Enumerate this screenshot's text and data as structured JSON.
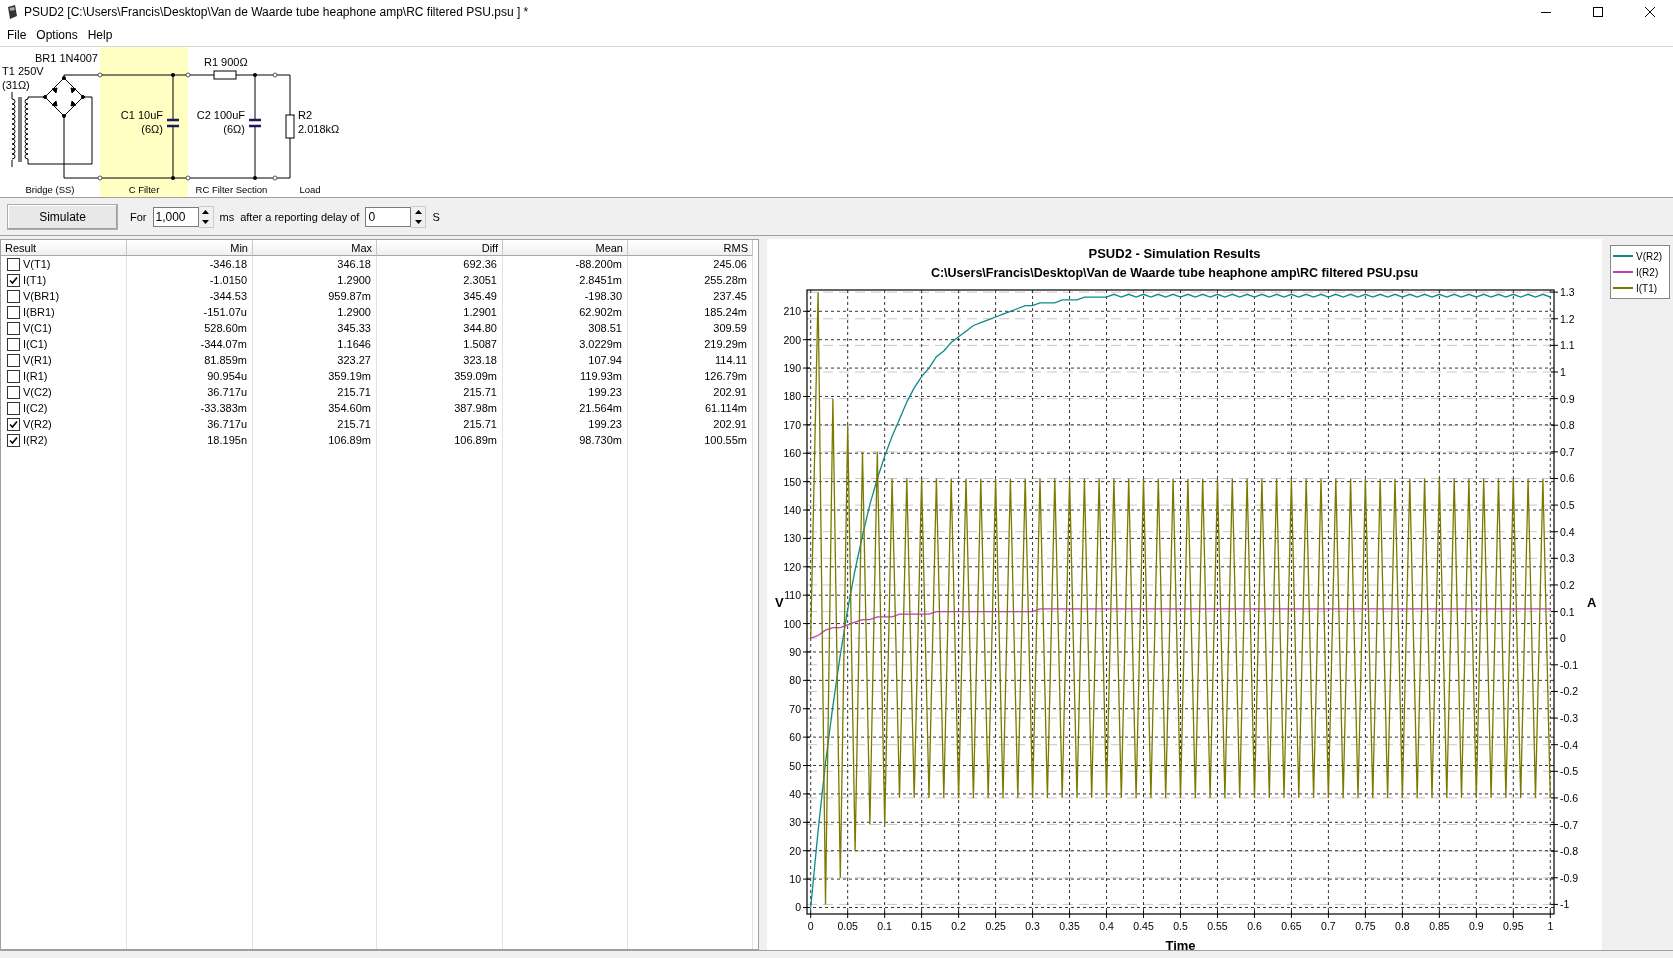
{
  "window": {
    "title": "PSUD2  [C:\\Users\\Francis\\Desktop\\Van de Waarde tube heaphone amp\\RC filtered PSU.psu ] *"
  },
  "menu": [
    "File",
    "Options",
    "Help"
  ],
  "schematic": {
    "components": [
      {
        "kind": "transformer",
        "label": "T1 250V",
        "detail": "(31Ω)"
      },
      {
        "kind": "bridge",
        "label": "BR1 1N4007"
      },
      {
        "kind": "capacitor",
        "label": "C1 10uF",
        "detail": "(6Ω)"
      },
      {
        "kind": "resistor",
        "label": "R1 900Ω"
      },
      {
        "kind": "capacitor",
        "label": "C2 100uF",
        "detail": "(6Ω)"
      },
      {
        "kind": "load",
        "label": "R2",
        "detail": "2.018kΩ"
      }
    ],
    "sections": [
      {
        "label": "Bridge (SS)",
        "selected": false
      },
      {
        "label": "C Filter",
        "selected": true
      },
      {
        "label": "RC Filter Section",
        "selected": false
      },
      {
        "label": "Load",
        "selected": false
      }
    ]
  },
  "controls": {
    "simulate": "Simulate",
    "for_label": "For",
    "duration": "1,000",
    "duration_unit": "ms",
    "delay_label": "after a reporting delay of",
    "delay": "0",
    "delay_unit": "S"
  },
  "results": {
    "columns": [
      "Result",
      "Min",
      "Max",
      "Diff",
      "Mean",
      "RMS"
    ],
    "rows": [
      {
        "result": "V(T1)",
        "checked": false,
        "min": "-346.18",
        "max": "346.18",
        "diff": "692.36",
        "mean": "-88.200m",
        "rms": "245.06"
      },
      {
        "result": "I(T1)",
        "checked": true,
        "min": "-1.0150",
        "max": "1.2900",
        "diff": "2.3051",
        "mean": "2.8451m",
        "rms": "255.28m"
      },
      {
        "result": "V(BR1)",
        "checked": false,
        "min": "-344.53",
        "max": "959.87m",
        "diff": "345.49",
        "mean": "-198.30",
        "rms": "237.45"
      },
      {
        "result": "I(BR1)",
        "checked": false,
        "min": "-151.07u",
        "max": "1.2900",
        "diff": "1.2901",
        "mean": "62.902m",
        "rms": "185.24m"
      },
      {
        "result": "V(C1)",
        "checked": false,
        "min": "528.60m",
        "max": "345.33",
        "diff": "344.80",
        "mean": "308.51",
        "rms": "309.59"
      },
      {
        "result": "I(C1)",
        "checked": false,
        "min": "-344.07m",
        "max": "1.1646",
        "diff": "1.5087",
        "mean": "3.0229m",
        "rms": "219.29m"
      },
      {
        "result": "V(R1)",
        "checked": false,
        "min": "81.859m",
        "max": "323.27",
        "diff": "323.18",
        "mean": "107.94",
        "rms": "114.11"
      },
      {
        "result": "I(R1)",
        "checked": false,
        "min": "90.954u",
        "max": "359.19m",
        "diff": "359.09m",
        "mean": "119.93m",
        "rms": "126.79m"
      },
      {
        "result": "V(C2)",
        "checked": false,
        "min": "36.717u",
        "max": "215.71",
        "diff": "215.71",
        "mean": "199.23",
        "rms": "202.91"
      },
      {
        "result": "I(C2)",
        "checked": false,
        "min": "-33.383m",
        "max": "354.60m",
        "diff": "387.98m",
        "mean": "21.564m",
        "rms": "61.114m"
      },
      {
        "result": "V(R2)",
        "checked": true,
        "min": "36.717u",
        "max": "215.71",
        "diff": "215.71",
        "mean": "199.23",
        "rms": "202.91"
      },
      {
        "result": "I(R2)",
        "checked": true,
        "min": "18.195n",
        "max": "106.89m",
        "diff": "106.89m",
        "mean": "98.730m",
        "rms": "100.55m"
      }
    ]
  },
  "results_chart": {
    "chart_data": {
      "type": "line",
      "title": "PSUD2 - Simulation Results",
      "subtitle": "C:\\Users\\Francis\\Desktop\\Van de Waarde tube heaphone amp\\RC filtered PSU.psu",
      "xlabel": "Time",
      "ylabel": "V",
      "y2label": "A",
      "x": [
        0,
        0.01,
        0.02,
        0.03,
        0.04,
        0.05,
        0.06,
        0.07,
        0.08,
        0.09,
        0.1,
        0.11,
        0.12,
        0.13,
        0.14,
        0.15,
        0.16,
        0.17,
        0.18,
        0.19,
        0.2,
        0.21,
        0.22,
        0.23,
        0.24,
        0.25,
        0.26,
        0.27,
        0.28,
        0.29,
        0.3,
        0.31,
        0.32,
        0.33,
        0.34,
        0.35,
        0.36,
        0.37,
        0.38,
        0.39,
        0.4,
        0.41,
        0.42,
        0.43,
        0.44,
        0.45,
        0.46,
        0.47,
        0.48,
        0.49,
        0.5,
        0.51,
        0.52,
        0.53,
        0.54,
        0.55,
        0.56,
        0.57,
        0.58,
        0.59,
        0.6,
        0.61,
        0.62,
        0.63,
        0.64,
        0.65,
        0.66,
        0.67,
        0.68,
        0.69,
        0.7,
        0.71,
        0.72,
        0.73,
        0.74,
        0.75,
        0.76,
        0.77,
        0.78,
        0.79,
        0.8,
        0.81,
        0.82,
        0.83,
        0.84,
        0.85,
        0.86,
        0.87,
        0.88,
        0.89,
        0.9,
        0.91,
        0.92,
        0.93,
        0.94,
        0.95,
        0.96,
        0.97,
        0.98,
        0.99,
        1
      ],
      "series": [
        {
          "name": "V(R2)",
          "color": "#0b8a8a",
          "axis": "y",
          "values": [
            0,
            27,
            51,
            71,
            89,
            105,
            119,
            131,
            142,
            151,
            159,
            166,
            172,
            178,
            183,
            187,
            190,
            194,
            196,
            199,
            201,
            203,
            205,
            206,
            207,
            208,
            209,
            210,
            211,
            212,
            212,
            213,
            213,
            213,
            214,
            214,
            214,
            215,
            215,
            215,
            215,
            216,
            215,
            216,
            215,
            216,
            215,
            216,
            215,
            216,
            215,
            216,
            215,
            216,
            215,
            216,
            215,
            216,
            215,
            216,
            215,
            216,
            215,
            216,
            215,
            216,
            215,
            216,
            215,
            216,
            215,
            216,
            215,
            216,
            215,
            216,
            215,
            216,
            215,
            216,
            215,
            216,
            215,
            216,
            215,
            216,
            215,
            216,
            215,
            216,
            215,
            216,
            215,
            216,
            215,
            216,
            215,
            216,
            215,
            216,
            215
          ]
        },
        {
          "name": "I(R2)",
          "color": "#c03cc0",
          "axis": "y2",
          "values": [
            0,
            0.01,
            0.03,
            0.04,
            0.04,
            0.05,
            0.06,
            0.07,
            0.07,
            0.08,
            0.08,
            0.08,
            0.09,
            0.09,
            0.09,
            0.09,
            0.09,
            0.1,
            0.1,
            0.1,
            0.1,
            0.1,
            0.1,
            0.1,
            0.1,
            0.1,
            0.1,
            0.1,
            0.1,
            0.1,
            0.1,
            0.11,
            0.11,
            0.11,
            0.11,
            0.11,
            0.11,
            0.11,
            0.11,
            0.11,
            0.11,
            0.11,
            0.11,
            0.11,
            0.11,
            0.11,
            0.11,
            0.11,
            0.11,
            0.11,
            0.11,
            0.11,
            0.11,
            0.11,
            0.11,
            0.11,
            0.11,
            0.11,
            0.11,
            0.11,
            0.11,
            0.11,
            0.11,
            0.11,
            0.11,
            0.11,
            0.11,
            0.11,
            0.11,
            0.11,
            0.11,
            0.11,
            0.11,
            0.11,
            0.11,
            0.11,
            0.11,
            0.11,
            0.11,
            0.11,
            0.11,
            0.11,
            0.11,
            0.11,
            0.11,
            0.11,
            0.11,
            0.11,
            0.11,
            0.11,
            0.11,
            0.11,
            0.11,
            0.11,
            0.11,
            0.11,
            0.11,
            0.11,
            0.11,
            0.11,
            0.11
          ]
        },
        {
          "name": "I(T1)",
          "color": "#7a7a00",
          "axis": "y2",
          "values": [
            0,
            1.3,
            -1.0,
            0.9,
            -0.9,
            0.8,
            -0.8,
            0.7,
            -0.7,
            0.7,
            -0.7,
            0.6,
            -0.6,
            0.6,
            -0.6,
            0.6,
            -0.6,
            0.6,
            -0.6,
            0.6,
            -0.6,
            0.6,
            -0.6,
            0.6,
            -0.6,
            0.6,
            -0.6,
            0.6,
            -0.6,
            0.6,
            -0.6,
            0.6,
            -0.6,
            0.6,
            -0.6,
            0.6,
            -0.6,
            0.6,
            -0.6,
            0.6,
            -0.6,
            0.6,
            -0.6,
            0.6,
            -0.6,
            0.6,
            -0.6,
            0.6,
            -0.6,
            0.6,
            -0.6,
            0.6,
            -0.6,
            0.6,
            -0.6,
            0.6,
            -0.6,
            0.6,
            -0.6,
            0.6,
            -0.6,
            0.6,
            -0.6,
            0.6,
            -0.6,
            0.6,
            -0.6,
            0.6,
            -0.6,
            0.6,
            -0.6,
            0.6,
            -0.6,
            0.6,
            -0.6,
            0.6,
            -0.6,
            0.6,
            -0.6,
            0.6,
            -0.6,
            0.6,
            -0.6,
            0.6,
            -0.6,
            0.6,
            -0.6,
            0.6,
            -0.6,
            0.6,
            -0.6,
            0.6,
            -0.6,
            0.6,
            -0.6,
            0.6,
            -0.6,
            0.6,
            -0.6,
            0.6,
            -0.6
          ]
        }
      ],
      "grid": true,
      "xlim": [
        -0.005,
        1.005
      ],
      "ylim": [
        -2.3,
        217.5
      ],
      "y2lim": [
        -1.036,
        1.308
      ],
      "xticks": [
        0,
        0.05,
        0.1,
        0.15,
        0.2,
        0.25,
        0.3,
        0.35,
        0.4,
        0.45,
        0.5,
        0.55,
        0.6,
        0.65,
        0.7,
        0.75,
        0.8,
        0.85,
        0.9,
        0.95,
        1
      ],
      "yticks": [
        0,
        10,
        20,
        30,
        40,
        50,
        60,
        70,
        80,
        90,
        100,
        110,
        120,
        130,
        140,
        150,
        160,
        170,
        180,
        190,
        200,
        210
      ],
      "y2ticks": [
        -1,
        -0.9,
        -0.8,
        -0.7,
        -0.6,
        -0.5,
        -0.4,
        -0.3,
        -0.2,
        -0.1,
        0,
        0.1,
        0.2,
        0.3,
        0.4,
        0.5,
        0.6,
        0.7,
        0.8,
        0.9,
        1,
        1.1,
        1.2,
        1.3
      ]
    }
  }
}
